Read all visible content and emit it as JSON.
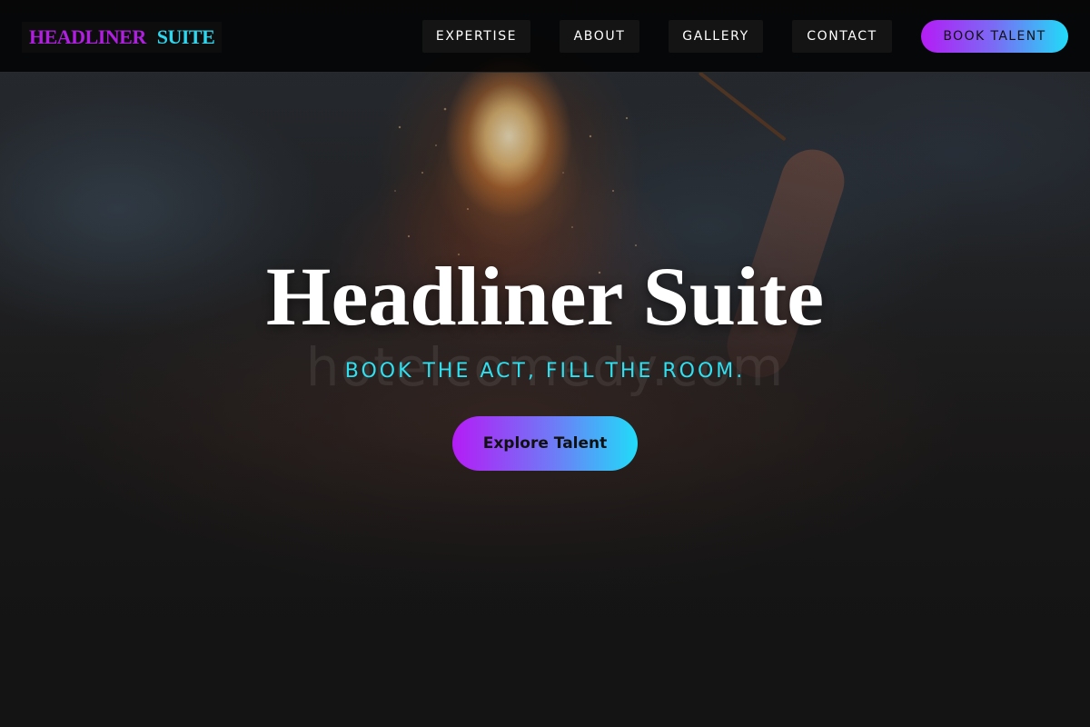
{
  "brand": {
    "word1": "HEADLINER",
    "word2": "SUITE"
  },
  "nav": {
    "links": [
      {
        "label": "EXPERTISE"
      },
      {
        "label": "ABOUT"
      },
      {
        "label": "GALLERY"
      },
      {
        "label": "CONTACT"
      }
    ],
    "book_label": "BOOK TALENT"
  },
  "hero": {
    "title": "Headliner Suite",
    "tagline": "BOOK THE ACT, FILL THE ROOM.",
    "watermark": "hotelcomedy.com",
    "cta_label": "Explore Talent",
    "background_image": "fire-performer-crowd"
  },
  "colors": {
    "accent_purple": "#b41cf5",
    "accent_cyan": "#20dcf8",
    "tagline": "#2ee0f0",
    "background": "#141414"
  }
}
